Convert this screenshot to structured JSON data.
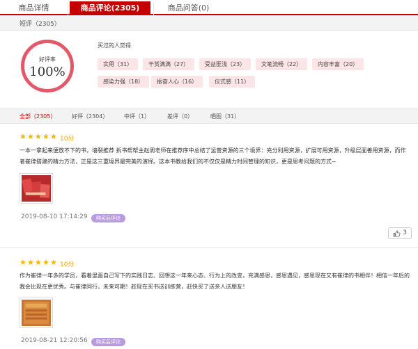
{
  "tabs": [
    {
      "label": "商品详情"
    },
    {
      "label": "商品评论(2305)"
    },
    {
      "label": "商品问答(0)"
    }
  ],
  "short_review_label": "短评（2305）",
  "rating": {
    "label": "好评率",
    "value": "100%"
  },
  "impressions_title": "买过的人觉得",
  "chips": [
    {
      "label": "实用（31）"
    },
    {
      "label": "干货满满（27）"
    },
    {
      "label": "受益匪浅（23）"
    },
    {
      "label": "文笔流畅（22）"
    },
    {
      "label": "内容丰富（20）"
    },
    {
      "label": "感染力强（18）"
    },
    {
      "label": "振奋人心（16）"
    },
    {
      "label": "仪式感（11）"
    }
  ],
  "filters": [
    {
      "label": "全部（2305）"
    },
    {
      "label": "好评（2304）"
    },
    {
      "label": "中评（1）"
    },
    {
      "label": "差评（0）"
    },
    {
      "label": "晒图（31）"
    }
  ],
  "reviews": [
    {
      "stars": 5,
      "score": "10分",
      "text": "一本一拿起来便放不下的书，墙裂推荐 拆书帮帮主赵周老师在推荐序中总结了运营资源的三个境界：充分利用资源，扩展可用资源，升级层面善用资源，而作者崔律搭建的精力方法，正是这三重境界最完美的演绎。这本书教给我们的不仅仅是精力时间管理的知识，更是思考问题的方式~",
      "time": "2019-08-10 17:14:29",
      "badge": "购买后评论",
      "likes": "3"
    },
    {
      "stars": 5,
      "score": "10分",
      "text": "作为崔律一年多的学员，看着里面自己写下的实践日志、回想这一年来心态、行为上的改变，充满感恩，感恩遇见，感恩现在又有崔律的书相伴！相信一年后的我会比现在更优秀。与崔律同行，未来可期！趁现在买书送训练营，赶快买了送亲人送朋友！",
      "time": "2019-08-21 12:20:56",
      "badge": "购买后评论"
    }
  ],
  "colors": {
    "accent": "#c40000",
    "ring": "#e25a6a",
    "chip_bg": "#fbe5e6",
    "star": "#f4b400",
    "badge": "#b99be0"
  }
}
